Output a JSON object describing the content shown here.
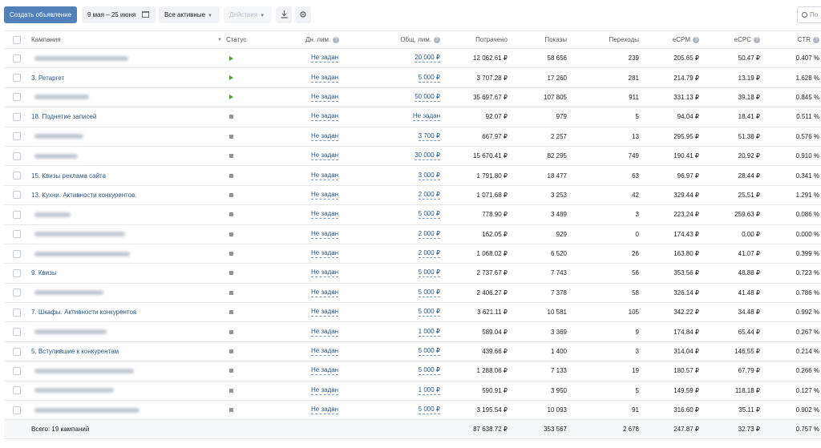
{
  "toolbar": {
    "create_label": "Создать объявление",
    "date_range": "9 мая – 25 июня",
    "filter_label": "Все активные",
    "actions_label": "Действия",
    "search_placeholder": "По"
  },
  "table": {
    "headers": {
      "campaign": "Кампания",
      "status": "Статус",
      "day_limit": "Дн. лим.",
      "total_limit": "Общ. лим.",
      "spent": "Потрачено",
      "shows": "Показы",
      "clicks": "Переходы",
      "ecpm": "eCPM",
      "ecpc": "eCPC",
      "ctr": "CTR"
    },
    "rows": [
      {
        "name": "",
        "blurred": true,
        "blur_len": 0.52,
        "status": "active",
        "day_limit": "Не задан",
        "total_limit": "20 000 ₽",
        "spent": "12 062.61 ₽",
        "shows": "58 656",
        "clicks": "239",
        "ecpm": "205.65 ₽",
        "ecpc": "50.47 ₽",
        "ctr": "0.407 %"
      },
      {
        "name": "3. Ретаргет",
        "blurred": false,
        "status": "active",
        "day_limit": "Не задан",
        "total_limit": "5 000 ₽",
        "spent": "3 707.28 ₽",
        "shows": "17 260",
        "clicks": "281",
        "ecpm": "214.79 ₽",
        "ecpc": "13.19 ₽",
        "ctr": "1.628 %"
      },
      {
        "name": "",
        "blurred": true,
        "blur_len": 0.3,
        "status": "active",
        "day_limit": "Не задан",
        "total_limit": "50 000 ₽",
        "spent": "35 697.67 ₽",
        "shows": "107 805",
        "clicks": "911",
        "ecpm": "331.13 ₽",
        "ecpc": "39.18 ₽",
        "ctr": "0.845 %"
      },
      {
        "name": "18. Поднятие записей",
        "blurred": false,
        "status": "stopped",
        "day_limit": "Не задан",
        "total_limit": "Не задан",
        "spent": "92.07 ₽",
        "shows": "979",
        "clicks": "5",
        "ecpm": "94.04 ₽",
        "ecpc": "18.41 ₽",
        "ctr": "0.511 %"
      },
      {
        "name": "",
        "blurred": true,
        "blur_len": 0.27,
        "status": "stopped",
        "day_limit": "Не задан",
        "total_limit": "3 700 ₽",
        "spent": "667.97 ₽",
        "shows": "2 257",
        "clicks": "13",
        "ecpm": "295.95 ₽",
        "ecpc": "51.38 ₽",
        "ctr": "0.576 %"
      },
      {
        "name": "",
        "blurred": true,
        "blur_len": 0.24,
        "status": "stopped",
        "day_limit": "Не задан",
        "total_limit": "30 000 ₽",
        "spent": "15 670.41 ₽",
        "shows": "82 295",
        "clicks": "749",
        "ecpm": "190.41 ₽",
        "ecpc": "20.92 ₽",
        "ctr": "0.910 %"
      },
      {
        "name": "15. Квизы реклама сайта",
        "blurred": false,
        "status": "stopped",
        "day_limit": "Не задан",
        "total_limit": "3 000 ₽",
        "spent": "1 791.80 ₽",
        "shows": "18 477",
        "clicks": "63",
        "ecpm": "96.97 ₽",
        "ecpc": "28.44 ₽",
        "ctr": "0.341 %"
      },
      {
        "name": "13. Кухни. Активности конкурентов.",
        "blurred": false,
        "status": "stopped",
        "day_limit": "Не задан",
        "total_limit": "2 000 ₽",
        "spent": "1 071.68 ₽",
        "shows": "3 253",
        "clicks": "42",
        "ecpm": "329.44 ₽",
        "ecpc": "25.51 ₽",
        "ctr": "1.291 %"
      },
      {
        "name": "",
        "blurred": true,
        "blur_len": 0.2,
        "status": "stopped",
        "day_limit": "Не задан",
        "total_limit": "5 000 ₽",
        "spent": "778.90 ₽",
        "shows": "3 489",
        "clicks": "3",
        "ecpm": "223.24 ₽",
        "ecpc": "259.63 ₽",
        "ctr": "0.086 %"
      },
      {
        "name": "",
        "blurred": true,
        "blur_len": 0.5,
        "status": "stopped",
        "day_limit": "Не задан",
        "total_limit": "2 000 ₽",
        "spent": "162.05 ₽",
        "shows": "929",
        "clicks": "0",
        "ecpm": "174.43 ₽",
        "ecpc": "0.00 ₽",
        "ctr": "0.000 %"
      },
      {
        "name": "",
        "blurred": true,
        "blur_len": 0.53,
        "status": "stopped",
        "day_limit": "Не задан",
        "total_limit": "2 000 ₽",
        "spent": "1 068.02 ₽",
        "shows": "6 520",
        "clicks": "26",
        "ecpm": "163.80 ₽",
        "ecpc": "41.07 ₽",
        "ctr": "0.399 %"
      },
      {
        "name": "9. Квизы",
        "blurred": false,
        "status": "stopped",
        "day_limit": "Не задан",
        "total_limit": "5 000 ₽",
        "spent": "2 737.67 ₽",
        "shows": "7 743",
        "clicks": "56",
        "ecpm": "353.56 ₽",
        "ecpc": "48.88 ₽",
        "ctr": "0.723 %"
      },
      {
        "name": "",
        "blurred": true,
        "blur_len": 0.38,
        "status": "stopped",
        "day_limit": "Не задан",
        "total_limit": "5 000 ₽",
        "spent": "2 406.27 ₽",
        "shows": "7 378",
        "clicks": "58",
        "ecpm": "326.14 ₽",
        "ecpc": "41.48 ₽",
        "ctr": "0.786 %"
      },
      {
        "name": "7. Шкафы. Активности конкурентов",
        "blurred": false,
        "status": "stopped",
        "day_limit": "Не задан",
        "total_limit": "5 000 ₽",
        "spent": "3 621.11 ₽",
        "shows": "10 581",
        "clicks": "105",
        "ecpm": "342.22 ₽",
        "ecpc": "34.48 ₽",
        "ctr": "0.992 %"
      },
      {
        "name": "",
        "blurred": true,
        "blur_len": 0.4,
        "status": "stopped",
        "day_limit": "Не задан",
        "total_limit": "1 000 ₽",
        "spent": "589.04 ₽",
        "shows": "3 369",
        "clicks": "9",
        "ecpm": "174.84 ₽",
        "ecpc": "65.44 ₽",
        "ctr": "0.267 %"
      },
      {
        "name": "5. Вступившие к конкурентам",
        "blurred": false,
        "status": "stopped",
        "day_limit": "Не задан",
        "total_limit": "5 000 ₽",
        "spent": "439.66 ₽",
        "shows": "1 400",
        "clicks": "3",
        "ecpm": "314.04 ₽",
        "ecpc": "146.55 ₽",
        "ctr": "0.214 %"
      },
      {
        "name": "",
        "blurred": true,
        "blur_len": 0.55,
        "status": "stopped",
        "day_limit": "Не задан",
        "total_limit": "5 000 ₽",
        "spent": "1 288.06 ₽",
        "shows": "7 133",
        "clicks": "19",
        "ecpm": "180.57 ₽",
        "ecpc": "67.79 ₽",
        "ctr": "0.266 %"
      },
      {
        "name": "",
        "blurred": true,
        "blur_len": 0.44,
        "status": "stopped",
        "day_limit": "Не задан",
        "total_limit": "1 000 ₽",
        "spent": "590.91 ₽",
        "shows": "3 950",
        "clicks": "5",
        "ecpm": "149.59 ₽",
        "ecpc": "118.18 ₽",
        "ctr": "0.127 %"
      },
      {
        "name": "",
        "blurred": true,
        "blur_len": 0.58,
        "status": "stopped",
        "day_limit": "Не задан",
        "total_limit": "5 000 ₽",
        "spent": "3 195.54 ₽",
        "shows": "10 093",
        "clicks": "91",
        "ecpm": "316.60 ₽",
        "ecpc": "35.11 ₽",
        "ctr": "0.902 %"
      }
    ],
    "total": {
      "label": "Всего: 19 кампаний",
      "spent": "87 638.72 ₽",
      "shows": "353 567",
      "clicks": "2 678",
      "ecpm": "247.87 ₽",
      "ecpc": "32.73 ₽",
      "ctr": "0.757 %"
    }
  },
  "colors": {
    "primary": "#5181b8",
    "link": "#2a5885",
    "status_active": "#5d9e39",
    "status_stopped": "#8f959c"
  }
}
